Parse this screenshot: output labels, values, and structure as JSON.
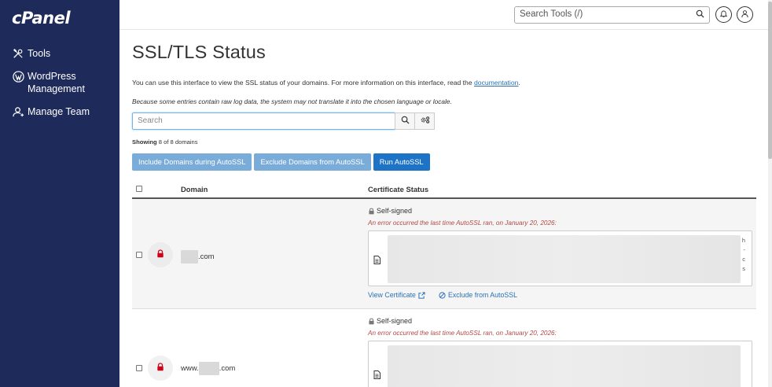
{
  "brand": {
    "logo": "cPanel"
  },
  "sidebar": {
    "items": [
      {
        "label": "Tools",
        "icon": "tools-icon"
      },
      {
        "label": "WordPress Management",
        "icon": "wordpress-icon"
      },
      {
        "label": "Manage Team",
        "icon": "manage-team-icon"
      }
    ]
  },
  "header": {
    "search_placeholder": "Search Tools (/)"
  },
  "page": {
    "title": "SSL/TLS Status",
    "intro_prefix": "You can use this interface to view the SSL status of your domains. For more information on this interface, read the ",
    "intro_link": "documentation",
    "intro_suffix": ".",
    "note": "Because some entries contain raw log data, the system may not translate it into the chosen language or locale.",
    "search_placeholder": "Search",
    "showing_label": "Showing",
    "showing_value": "8 of 8 domains",
    "buttons": {
      "include": "Include Domains during AutoSSL",
      "exclude": "Exclude Domains from AutoSSL",
      "run": "Run AutoSSL"
    }
  },
  "table": {
    "headers": {
      "domain": "Domain",
      "status": "Certificate Status"
    },
    "rows": [
      {
        "domain_suffix": ".com",
        "domain_prefix": "",
        "status": "Self-signed",
        "error": "An error occurred the last time AutoSSL ran, on January 20, 2026:",
        "side_letters": [
          "h",
          "-",
          "c",
          "s"
        ],
        "view_cert": "View Certificate",
        "exclude": "Exclude from AutoSSL"
      },
      {
        "domain_prefix": "www.",
        "domain_suffix": ".com",
        "status": "Self-signed",
        "error": "An error occurred the last time AutoSSL ran, on January 20, 2026:"
      }
    ]
  },
  "colors": {
    "sidebar_bg": "#1d2a5a",
    "primary": "#1d74c6",
    "primary_light": "#7aacd9",
    "error": "#b04a45",
    "lock_red": "#d0021b",
    "link": "#2b72b5"
  }
}
